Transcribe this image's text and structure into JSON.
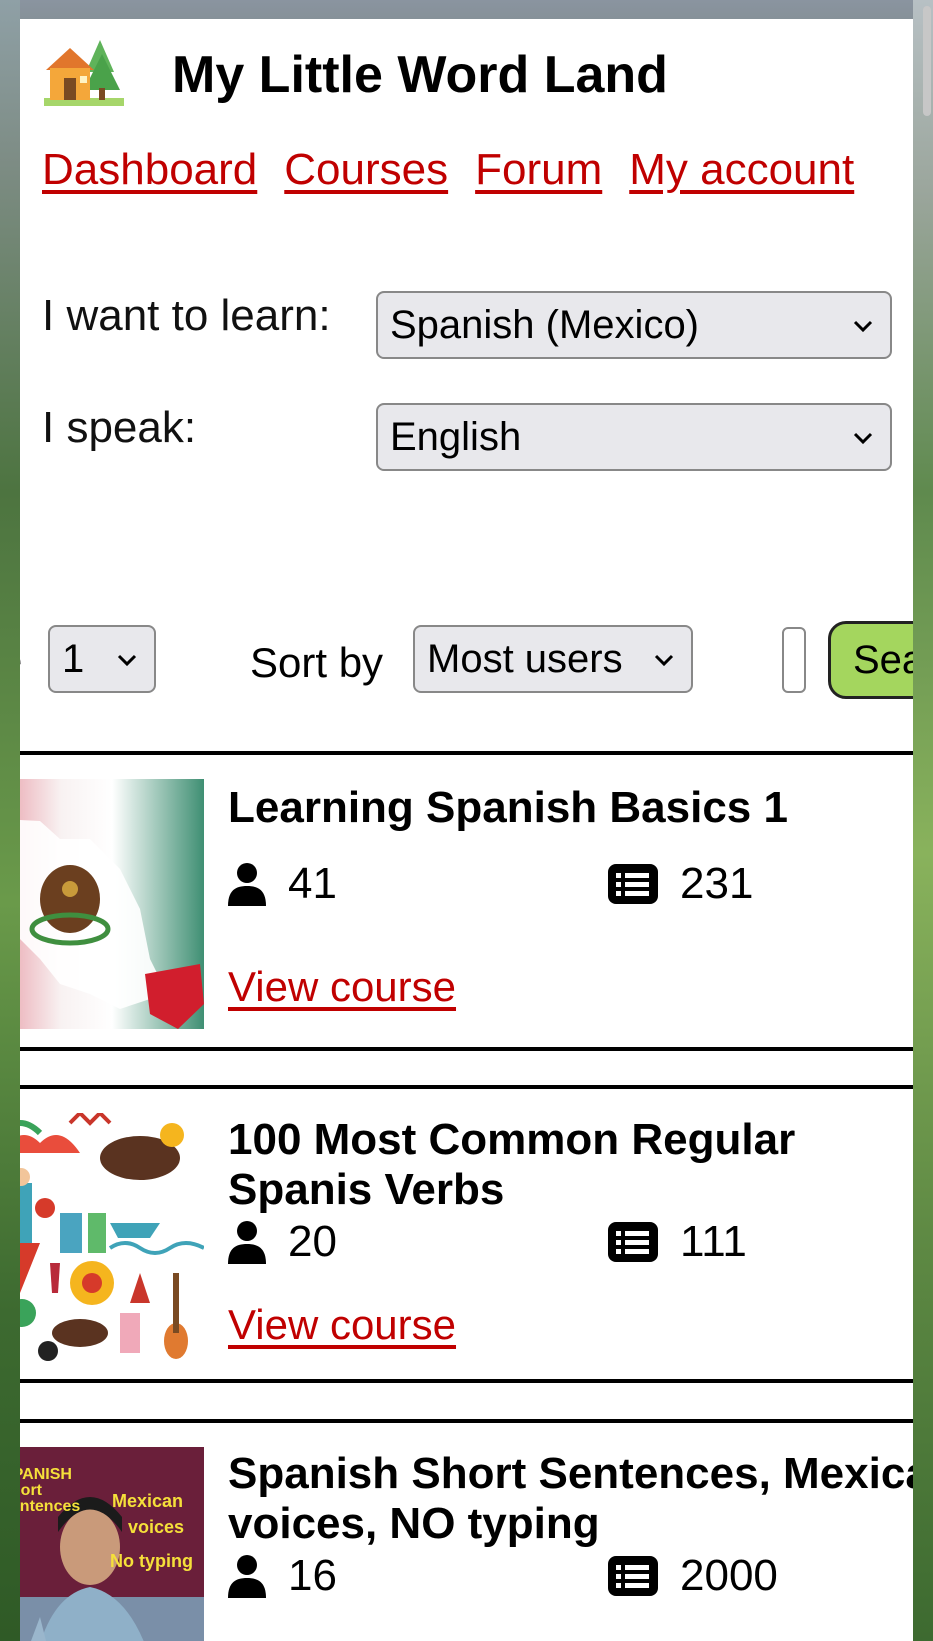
{
  "site": {
    "title": "My Little Word Land",
    "logo_icon": "house-tree-icon"
  },
  "nav": [
    {
      "label": "Dashboard"
    },
    {
      "label": "Courses"
    },
    {
      "label": "Forum"
    },
    {
      "label": "My account"
    }
  ],
  "filters": {
    "learn_label": "I want to learn:",
    "learn_value": "Spanish (Mexico)",
    "speak_label": "I speak:",
    "speak_value": "English",
    "page_label_fragment": "e",
    "page_value": "1",
    "sort_label": "Sort by",
    "sort_value": "Most users",
    "search_value": "",
    "search_button": "Sear"
  },
  "courses": [
    {
      "title": "Learning Spanish Basics 1",
      "users": "41",
      "items": "231",
      "link": "View course",
      "thumb": "mexico-flag-map"
    },
    {
      "title": "100 Most Common Regular Spanis Verbs",
      "users": "20",
      "items": "111",
      "link": "View course",
      "thumb": "spain-icons-pattern"
    },
    {
      "title": "Spanish Short Sentences, Mexica voices, NO typing",
      "users": "16",
      "items": "2000",
      "link": "View course",
      "thumb": "frida-photo",
      "thumb_text": [
        "SPANISH",
        "short",
        "sentences",
        "Mexican",
        "voices",
        "No typing"
      ]
    }
  ],
  "colors": {
    "link": "#c00000",
    "search_button": "#a4d65e",
    "select_bg": "#e8e8ec"
  }
}
